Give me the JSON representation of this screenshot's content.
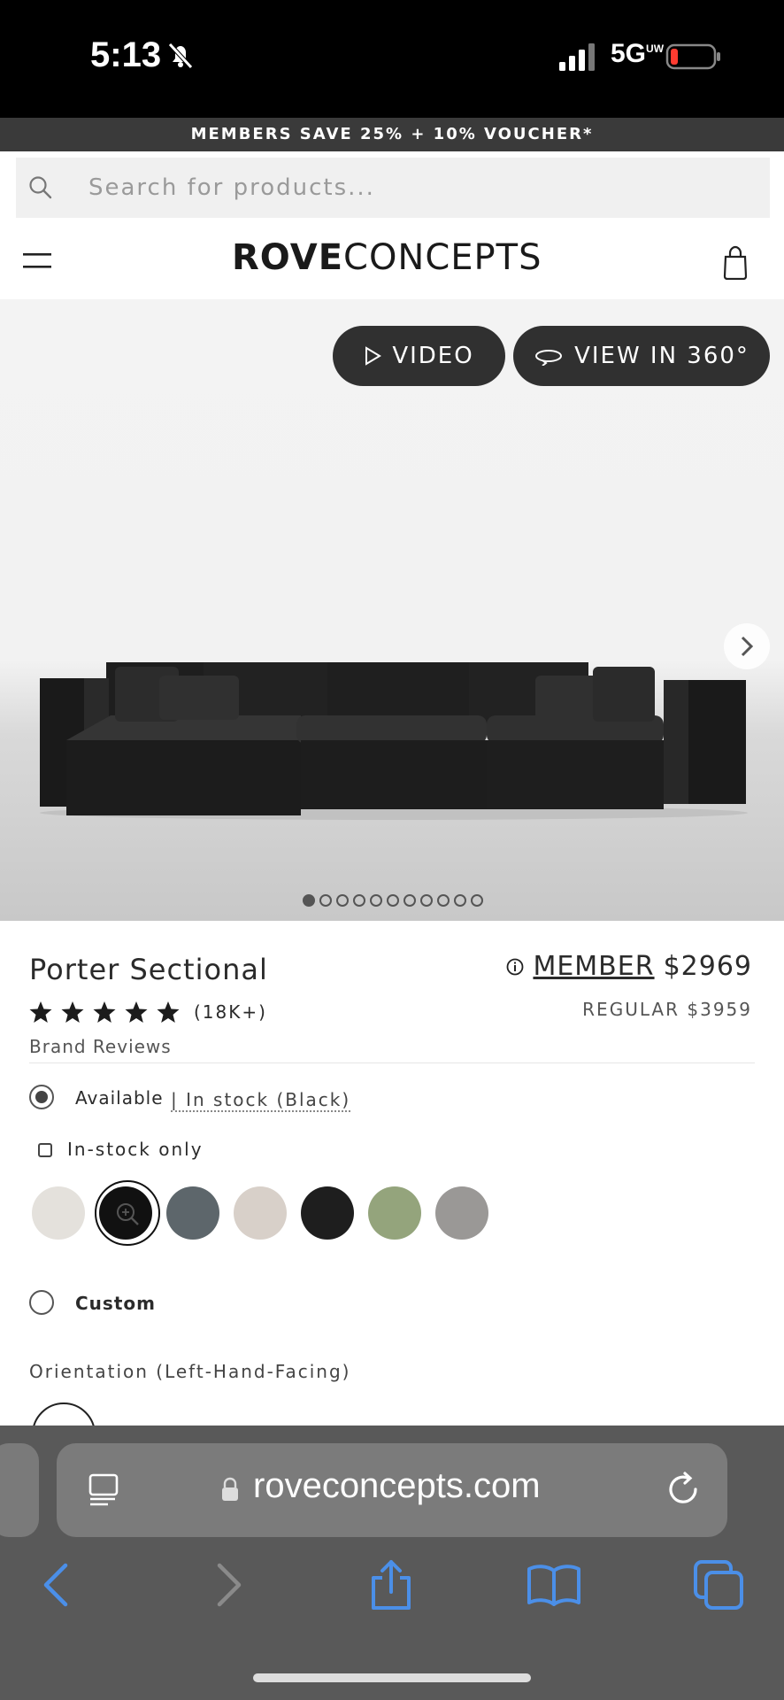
{
  "status_bar": {
    "time": "5:13",
    "network": "5G",
    "network_sup": "UW"
  },
  "promo": {
    "text": "MEMBERS SAVE 25% + 10% VOUCHER*"
  },
  "search": {
    "placeholder": "Search for products..."
  },
  "header": {
    "logo_bold": "ROVE",
    "logo_thin": "CONCEPTS"
  },
  "hero": {
    "video_label": "VIDEO",
    "view360_label": "VIEW IN 360°",
    "image_count": 11,
    "active_image_index": 0
  },
  "product": {
    "title": "Porter Sectional",
    "member_label": "MEMBER",
    "member_price": "$2969",
    "regular_price": "REGULAR $3959",
    "rating": 5,
    "review_count": "(18K+)",
    "brand_reviews": "Brand Reviews",
    "available_label": "Available",
    "stock_status": "| In stock (Black)",
    "instock_only_label": "In-stock only",
    "swatches": [
      {
        "name": "cream",
        "color": "#e4e1dc",
        "selected": false
      },
      {
        "name": "black",
        "color": "#111111",
        "selected": true
      },
      {
        "name": "slate",
        "color": "#5d666b",
        "selected": false
      },
      {
        "name": "boucle",
        "color": "#d8d0c9",
        "selected": false
      },
      {
        "name": "black-textured",
        "color": "#1e1e1e",
        "selected": false
      },
      {
        "name": "sage",
        "color": "#94a47c",
        "selected": false
      },
      {
        "name": "grey",
        "color": "#9a9896",
        "selected": false
      }
    ],
    "custom_label": "Custom",
    "orientation_label": "Orientation (Left-Hand-Facing)"
  },
  "browser": {
    "url": "roveconcepts.com"
  },
  "colors": {
    "accent_blue": "#4b8fe8",
    "dark_button": "#303030",
    "promo_bg": "#3a3a3a"
  }
}
